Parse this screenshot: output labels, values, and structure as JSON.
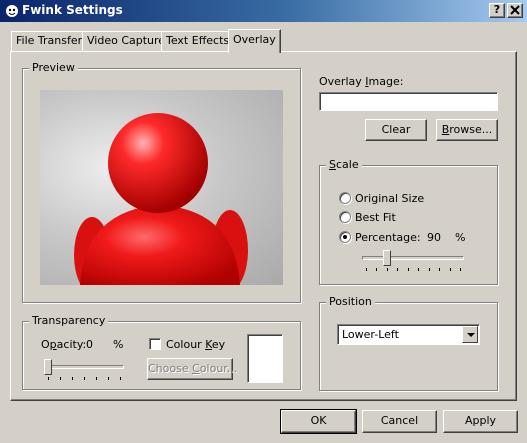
{
  "window": {
    "title": "Fwink Settings",
    "help_button": "?",
    "close_button": "✕"
  },
  "tabs": [
    {
      "label": "File Transfer"
    },
    {
      "label": "Video Capture"
    },
    {
      "label": "Text Effects"
    },
    {
      "label": "Overlay",
      "active": true
    }
  ],
  "preview": {
    "title": "Preview"
  },
  "overlay_image": {
    "label_underlined": "I",
    "label_prefix": "Overlay ",
    "label_suffix": "mage:",
    "value": "",
    "clear_label": "Clear",
    "browse_label_underlined": "B",
    "browse_label_rest": "rowse..."
  },
  "scale": {
    "title_underlined": "S",
    "title_rest": "cale",
    "options": [
      {
        "label": "Original Size",
        "selected": false
      },
      {
        "label": "Best Fit",
        "selected": false
      },
      {
        "label": "Percentage:",
        "selected": true
      }
    ],
    "percentage_value": "90",
    "percentage_unit": "%",
    "slider_fraction": 0.22
  },
  "transparency": {
    "title": "Transparency",
    "opacity_prefix": "O",
    "opacity_underlined": "p",
    "opacity_suffix": "acity:",
    "opacity_value": "0",
    "opacity_unit": "%",
    "slider_fraction": 0.0,
    "colour_key_prefix": "Colour ",
    "colour_key_underlined": "K",
    "colour_key_suffix": "ey",
    "colour_key_checked": false,
    "choose_colour_prefix": "Choose ",
    "choose_colour_underlined": "C",
    "choose_colour_suffix": "olour...",
    "swatch_color": "#ffffff"
  },
  "position": {
    "title": "Position",
    "selected": "Lower-Left"
  },
  "footer": {
    "ok_label": "OK",
    "cancel_label": "Cancel",
    "apply_label": "Apply"
  },
  "colors": {
    "face": "#d4d0c8",
    "title_start": "#0a246a",
    "title_end": "#a6caf0",
    "figure": "#e8141a"
  }
}
